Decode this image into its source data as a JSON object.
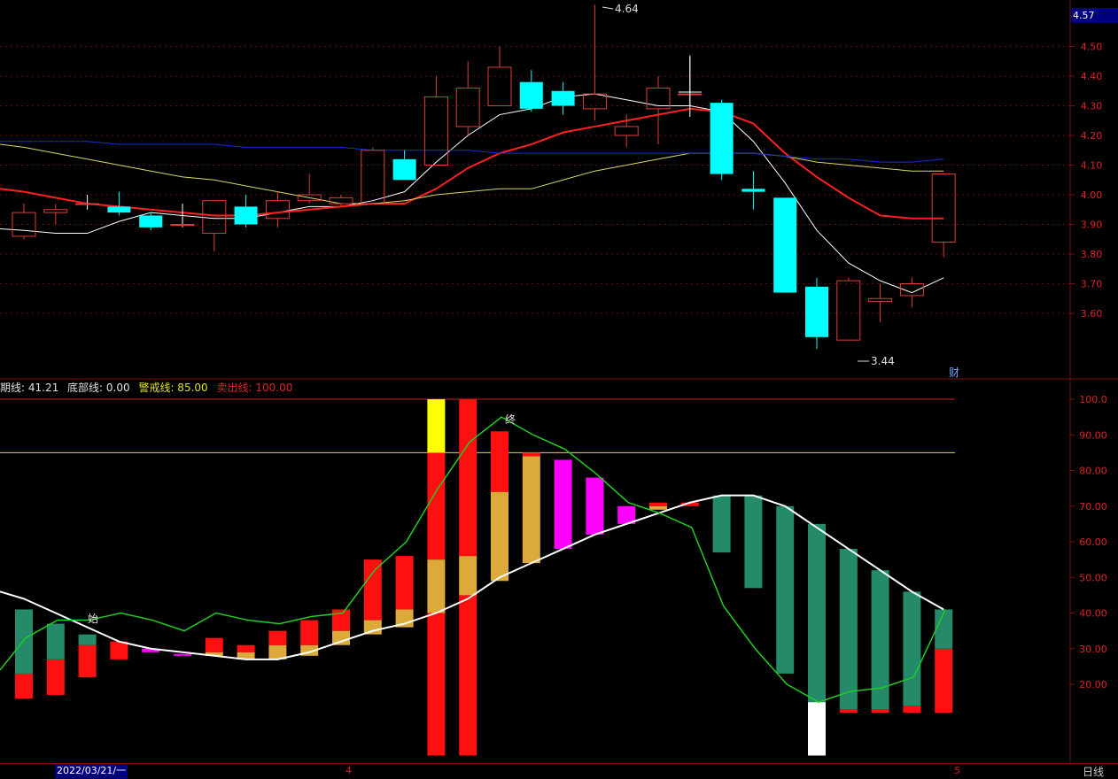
{
  "colors": {
    "background": "#000000",
    "frame": "#7a1010",
    "up_candle": "#e03c3c",
    "down_candle": "#00ffff",
    "ma_white": "#ffffff",
    "ma_red": "#ff2020",
    "ma_yellow": "#d8d860",
    "ma_blue": "#1a2ad8",
    "bar_red": "#ff1010",
    "bar_gold": "#dcaa3a",
    "bar_magenta": "#ff00ff",
    "bar_green": "#258a6a",
    "bar_yellow": "#ffff00",
    "bar_white": "#ffffff",
    "line_green": "#22cc22",
    "warn_line": "#e0e020",
    "sell_line": "#cc2222",
    "axis_text": "#c8c8c8",
    "axis_text_red": "#dd2222",
    "badge_bg": "#00007e"
  },
  "header": {
    "current_price": "4.57",
    "price_high_marker": "4.64",
    "price_low_marker": "3.44",
    "finance_marker": "财"
  },
  "indicator_legend": {
    "cycle_label": "期线: 41.21",
    "bottom_label": "底部线: 0.00",
    "warn_label": "警戒线: 85.00",
    "sell_label": "卖出线: 100.00"
  },
  "footer": {
    "date": "2022/03/21/一",
    "tick_4": "4",
    "tick_5": "5",
    "period": "日线"
  },
  "markers": {
    "start": "始",
    "end": "终"
  },
  "chart_data": [
    {
      "type": "candlestick",
      "title": "",
      "ylim": [
        3.44,
        4.64
      ],
      "y_ticks": [
        3.6,
        3.7,
        3.8,
        3.9,
        4.0,
        4.1,
        4.2,
        4.3,
        4.4,
        4.5
      ],
      "y_tick_labels": [
        "3.60",
        "3.70",
        "3.80",
        "3.90",
        "4.00",
        "4.10",
        "4.20",
        "4.30",
        "4.40",
        "4.50"
      ],
      "grid": true,
      "candles": [
        {
          "open": 3.86,
          "close": 3.94,
          "high": 3.97,
          "low": 3.85
        },
        {
          "open": 3.94,
          "close": 3.95,
          "high": 3.97,
          "low": 3.9
        },
        {
          "open": 3.97,
          "close": 3.97,
          "high": 4.0,
          "low": 3.95
        },
        {
          "open": 3.96,
          "close": 3.94,
          "high": 4.01,
          "low": 3.93
        },
        {
          "open": 3.93,
          "close": 3.89,
          "high": 3.94,
          "low": 3.88
        },
        {
          "open": 3.9,
          "close": 3.9,
          "high": 3.97,
          "low": 3.89
        },
        {
          "open": 3.87,
          "close": 3.98,
          "high": 3.98,
          "low": 3.81
        },
        {
          "open": 3.96,
          "close": 3.9,
          "high": 4.0,
          "low": 3.89
        },
        {
          "open": 3.92,
          "close": 3.98,
          "high": 4.01,
          "low": 3.89
        },
        {
          "open": 3.98,
          "close": 4.0,
          "high": 4.07,
          "low": 3.97
        },
        {
          "open": 3.97,
          "close": 3.99,
          "high": 4.0,
          "low": 3.96
        },
        {
          "open": 3.97,
          "close": 4.15,
          "high": 4.16,
          "low": 3.97
        },
        {
          "open": 4.12,
          "close": 4.05,
          "high": 4.15,
          "low": 4.05
        },
        {
          "open": 4.1,
          "close": 4.33,
          "high": 4.4,
          "low": 4.1
        },
        {
          "open": 4.23,
          "close": 4.36,
          "high": 4.45,
          "low": 4.2
        },
        {
          "open": 4.3,
          "close": 4.43,
          "high": 4.5,
          "low": 4.3
        },
        {
          "open": 4.38,
          "close": 4.29,
          "high": 4.42,
          "low": 4.28
        },
        {
          "open": 4.35,
          "close": 4.3,
          "high": 4.38,
          "low": 4.27
        },
        {
          "open": 4.29,
          "close": 4.34,
          "high": 4.64,
          "low": 4.25
        },
        {
          "open": 4.2,
          "close": 4.23,
          "high": 4.27,
          "low": 4.16
        },
        {
          "open": 4.29,
          "close": 4.36,
          "high": 4.4,
          "low": 4.17
        },
        {
          "open": 4.34,
          "close": 4.34,
          "high": 4.47,
          "low": 4.3
        },
        {
          "open": 4.31,
          "close": 4.07,
          "high": 4.32,
          "low": 4.05
        },
        {
          "open": 4.02,
          "close": 4.01,
          "high": 4.08,
          "low": 3.95
        },
        {
          "open": 3.99,
          "close": 3.67,
          "high": 3.99,
          "low": 3.67
        },
        {
          "open": 3.69,
          "close": 3.52,
          "high": 3.72,
          "low": 3.48
        },
        {
          "open": 3.51,
          "close": 3.71,
          "high": 3.72,
          "low": 3.51
        },
        {
          "open": 3.64,
          "close": 3.65,
          "high": 3.7,
          "low": 3.57
        },
        {
          "open": 3.66,
          "close": 3.7,
          "high": 3.72,
          "low": 3.62
        },
        {
          "open": 3.84,
          "close": 4.07,
          "high": 4.07,
          "low": 3.79
        }
      ],
      "moving_averages": [
        {
          "color": "#ffffff",
          "values": [
            3.88,
            3.87,
            3.87,
            3.91,
            3.94,
            3.93,
            3.92,
            3.92,
            3.94,
            3.96,
            3.96,
            3.98,
            4.01,
            4.11,
            4.2,
            4.27,
            4.29,
            4.33,
            4.34,
            4.32,
            4.3,
            4.3,
            4.28,
            4.18,
            4.04,
            3.88,
            3.77,
            3.71,
            3.67,
            3.72
          ]
        },
        {
          "color": "#ff2020",
          "values": [
            4.01,
            3.99,
            3.97,
            3.96,
            3.95,
            3.94,
            3.93,
            3.93,
            3.94,
            3.95,
            3.96,
            3.97,
            3.97,
            4.02,
            4.09,
            4.14,
            4.17,
            4.21,
            4.23,
            4.25,
            4.27,
            4.29,
            4.28,
            4.24,
            4.14,
            4.06,
            3.99,
            3.93,
            3.92,
            3.92
          ]
        },
        {
          "color": "#d8d860",
          "values": [
            4.16,
            4.14,
            4.12,
            4.1,
            4.08,
            4.06,
            4.05,
            4.03,
            4.01,
            3.99,
            3.97,
            3.97,
            3.98,
            4.0,
            4.01,
            4.02,
            4.02,
            4.05,
            4.08,
            4.1,
            4.12,
            4.14,
            4.14,
            4.14,
            4.13,
            4.11,
            4.1,
            4.09,
            4.08,
            4.08
          ]
        },
        {
          "color": "#1a2ad8",
          "values": [
            4.18,
            4.18,
            4.18,
            4.17,
            4.17,
            4.17,
            4.17,
            4.16,
            4.16,
            4.16,
            4.16,
            4.15,
            4.15,
            4.15,
            4.15,
            4.14,
            4.14,
            4.14,
            4.14,
            4.14,
            4.14,
            4.14,
            4.14,
            4.14,
            4.13,
            4.12,
            4.12,
            4.11,
            4.11,
            4.12
          ]
        }
      ]
    },
    {
      "type": "bar",
      "title": "",
      "ylim": [
        0,
        100
      ],
      "y_ticks": [
        20,
        30,
        40,
        50,
        60,
        70,
        80,
        90,
        100
      ],
      "y_tick_labels": [
        "20.00",
        "30.00",
        "40.00",
        "50.00",
        "60.00",
        "70.00",
        "80.00",
        "90.00",
        "100.0"
      ],
      "reference_lines": [
        {
          "name": "警戒线",
          "value": 85,
          "color": "#e0e020"
        },
        {
          "name": "卖出线",
          "value": 100,
          "color": "#cc2222"
        }
      ],
      "stacked_bars": [
        {
          "segments": [
            {
              "from": 16,
              "to": 23,
              "color": "#ff1010"
            },
            {
              "from": 23,
              "to": 41,
              "color": "#258a6a"
            }
          ]
        },
        {
          "segments": [
            {
              "from": 17,
              "to": 27,
              "color": "#ff1010"
            },
            {
              "from": 27,
              "to": 37,
              "color": "#258a6a"
            }
          ]
        },
        {
          "segments": [
            {
              "from": 22,
              "to": 31,
              "color": "#ff1010"
            },
            {
              "from": 31,
              "to": 34,
              "color": "#258a6a"
            }
          ]
        },
        {
          "segments": [
            {
              "from": 27,
              "to": 32,
              "color": "#ff1010"
            }
          ]
        },
        {
          "segments": [
            {
              "from": 29,
              "to": 30,
              "color": "#ff00ff"
            }
          ]
        },
        {
          "segments": [
            {
              "from": 28,
              "to": 28.5,
              "color": "#ff00ff"
            }
          ]
        },
        {
          "segments": [
            {
              "from": 28,
              "to": 29,
              "color": "#dcaa3a"
            },
            {
              "from": 29,
              "to": 33,
              "color": "#ff1010"
            }
          ]
        },
        {
          "segments": [
            {
              "from": 27,
              "to": 29,
              "color": "#dcaa3a"
            },
            {
              "from": 29,
              "to": 31,
              "color": "#ff1010"
            }
          ]
        },
        {
          "segments": [
            {
              "from": 27,
              "to": 31,
              "color": "#dcaa3a"
            },
            {
              "from": 31,
              "to": 35,
              "color": "#ff1010"
            }
          ]
        },
        {
          "segments": [
            {
              "from": 28,
              "to": 31,
              "color": "#dcaa3a"
            },
            {
              "from": 31,
              "to": 38,
              "color": "#ff1010"
            }
          ]
        },
        {
          "segments": [
            {
              "from": 31,
              "to": 35,
              "color": "#dcaa3a"
            },
            {
              "from": 35,
              "to": 41,
              "color": "#ff1010"
            }
          ]
        },
        {
          "segments": [
            {
              "from": 34,
              "to": 38,
              "color": "#dcaa3a"
            },
            {
              "from": 38,
              "to": 55,
              "color": "#ff1010"
            }
          ]
        },
        {
          "segments": [
            {
              "from": 36,
              "to": 41,
              "color": "#dcaa3a"
            },
            {
              "from": 41,
              "to": 56,
              "color": "#ff1010"
            }
          ]
        },
        {
          "segments": [
            {
              "from": 0,
              "to": 40,
              "color": "#ff1010"
            },
            {
              "from": 40,
              "to": 55,
              "color": "#dcaa3a"
            },
            {
              "from": 55,
              "to": 85,
              "color": "#ff1010"
            },
            {
              "from": 85,
              "to": 101,
              "color": "#ffff00"
            }
          ]
        },
        {
          "segments": [
            {
              "from": 0,
              "to": 45,
              "color": "#ff1010"
            },
            {
              "from": 45,
              "to": 56,
              "color": "#dcaa3a"
            },
            {
              "from": 56,
              "to": 101,
              "color": "#ff1010"
            }
          ]
        },
        {
          "segments": [
            {
              "from": 49,
              "to": 74,
              "color": "#dcaa3a"
            },
            {
              "from": 74,
              "to": 91,
              "color": "#ff1010"
            }
          ]
        },
        {
          "segments": [
            {
              "from": 54,
              "to": 84,
              "color": "#dcaa3a"
            },
            {
              "from": 84,
              "to": 85,
              "color": "#ff1010"
            }
          ]
        },
        {
          "segments": [
            {
              "from": 58,
              "to": 83,
              "color": "#ff00ff"
            }
          ]
        },
        {
          "segments": [
            {
              "from": 62,
              "to": 78,
              "color": "#ff00ff"
            }
          ]
        },
        {
          "segments": [
            {
              "from": 65,
              "to": 70,
              "color": "#ff00ff"
            }
          ]
        },
        {
          "segments": [
            {
              "from": 69,
              "to": 70,
              "color": "#dcaa3a"
            },
            {
              "from": 70,
              "to": 71,
              "color": "#ff1010"
            }
          ]
        },
        {
          "segments": [
            {
              "from": 70,
              "to": 71,
              "color": "#ff1010"
            }
          ]
        },
        {
          "segments": [
            {
              "from": 57,
              "to": 73,
              "color": "#258a6a"
            }
          ]
        },
        {
          "segments": [
            {
              "from": 47,
              "to": 73,
              "color": "#258a6a"
            }
          ]
        },
        {
          "segments": [
            {
              "from": 23,
              "to": 70,
              "color": "#258a6a"
            }
          ]
        },
        {
          "segments": [
            {
              "from": 0,
              "to": 15,
              "color": "#ffffff"
            },
            {
              "from": 15,
              "to": 65,
              "color": "#258a6a"
            }
          ]
        },
        {
          "segments": [
            {
              "from": 12,
              "to": 13,
              "color": "#ff1010"
            },
            {
              "from": 13,
              "to": 58,
              "color": "#258a6a"
            }
          ]
        },
        {
          "segments": [
            {
              "from": 12,
              "to": 13,
              "color": "#ff1010"
            },
            {
              "from": 13,
              "to": 52,
              "color": "#258a6a"
            }
          ]
        },
        {
          "segments": [
            {
              "from": 12,
              "to": 14,
              "color": "#ff1010"
            },
            {
              "from": 14,
              "to": 46,
              "color": "#258a6a"
            }
          ]
        },
        {
          "segments": [
            {
              "from": 12,
              "to": 30,
              "color": "#ff1010"
            },
            {
              "from": 30,
              "to": 41,
              "color": "#258a6a"
            }
          ]
        }
      ],
      "lines": [
        {
          "color": "#ffffff",
          "values": [
            44,
            40,
            36,
            32,
            30,
            29,
            28,
            27,
            27,
            29,
            32,
            35,
            37,
            40,
            44,
            50,
            54,
            58,
            62,
            65,
            68,
            71,
            73,
            73,
            70,
            64,
            58,
            52,
            46,
            41
          ]
        },
        {
          "color": "#22cc22",
          "values": [
            24,
            33,
            38,
            38,
            40,
            38,
            35,
            40,
            38,
            37,
            39,
            40,
            52,
            60,
            75,
            88,
            95,
            90,
            86,
            79,
            71,
            68,
            64,
            42,
            30,
            20,
            15,
            18,
            19,
            22,
            41
          ]
        }
      ]
    }
  ]
}
